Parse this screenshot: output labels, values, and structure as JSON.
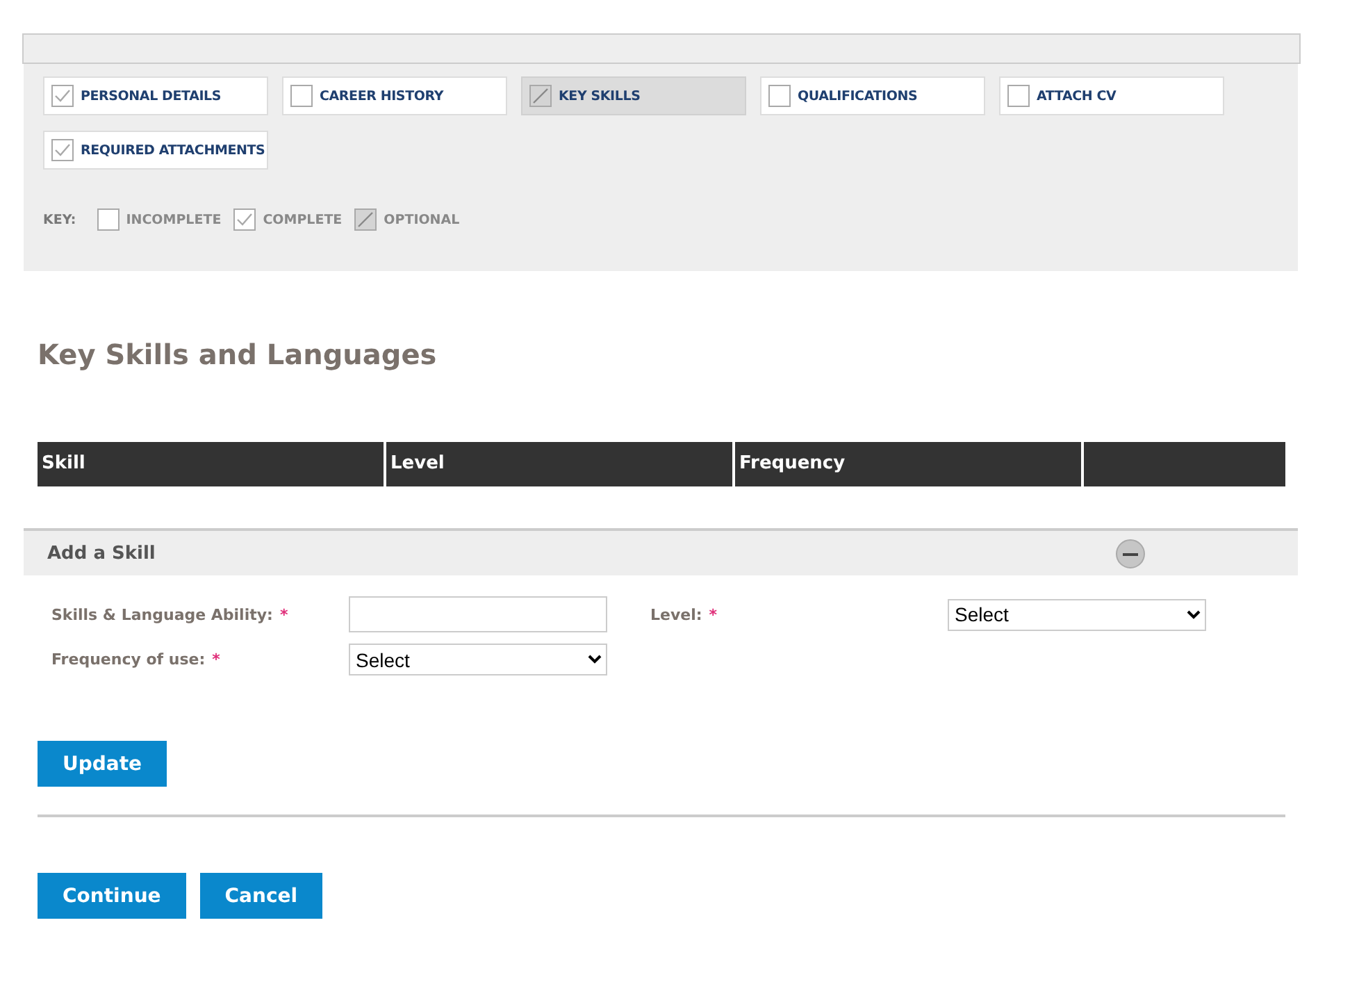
{
  "steps": [
    {
      "label": "PERSONAL DETAILS",
      "kind": "complete",
      "selected": false
    },
    {
      "label": "CAREER HISTORY",
      "kind": "incomplete",
      "selected": false
    },
    {
      "label": "KEY SKILLS",
      "kind": "optional",
      "selected": true
    },
    {
      "label": "QUALIFICATIONS",
      "kind": "incomplete",
      "selected": false
    },
    {
      "label": "ATTACH CV",
      "kind": "incomplete",
      "selected": false
    },
    {
      "label": "REQUIRED ATTACHMENTS",
      "kind": "complete",
      "selected": false
    }
  ],
  "key": {
    "label": "KEY:",
    "items": [
      {
        "label": "INCOMPLETE",
        "kind": "incomplete"
      },
      {
        "label": "COMPLETE",
        "kind": "complete"
      },
      {
        "label": "OPTIONAL",
        "kind": "optional"
      }
    ]
  },
  "heading": "Key Skills and Languages",
  "table": {
    "columns": [
      "Skill",
      "Level",
      "Frequency"
    ]
  },
  "add_skill": {
    "title": "Add a Skill",
    "expanded": true,
    "fields": [
      {
        "label": "Skills & Language Ability:",
        "required": true,
        "kind": "text"
      },
      {
        "label": "Level:",
        "required": true,
        "kind": "select",
        "value": "Select"
      },
      {
        "label": "Frequency of use:",
        "required": true,
        "kind": "select",
        "value": "Select"
      }
    ],
    "required_mark": "*",
    "button": "Update"
  },
  "buttons": [
    "Continue",
    "Cancel"
  ]
}
